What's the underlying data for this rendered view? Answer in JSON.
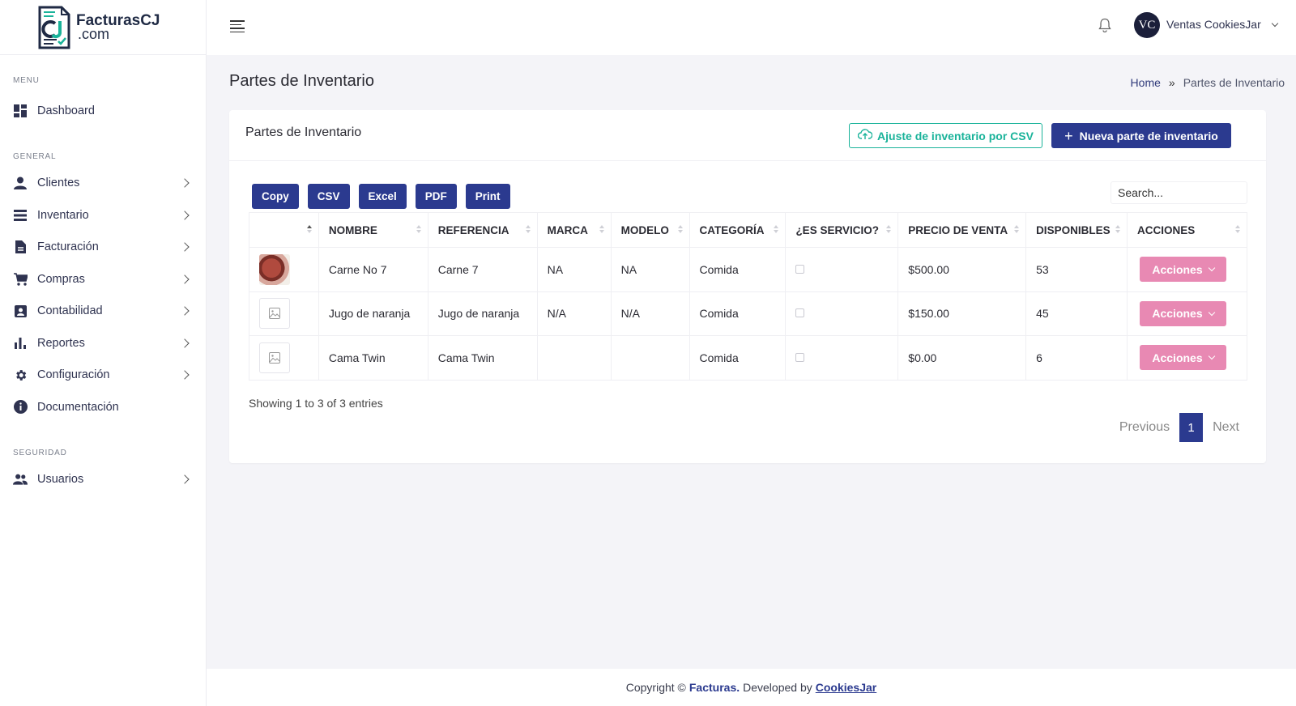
{
  "app": {
    "logo_top": "FacturasCJ",
    "logo_bottom": ".com"
  },
  "sidebar": {
    "sections": [
      {
        "title": "MENU"
      },
      {
        "title": "GENERAL"
      },
      {
        "title": "SEGURIDAD"
      }
    ],
    "items": [
      {
        "label": "Dashboard",
        "icon": "dashboard-grid-icon"
      },
      {
        "label": "Clientes",
        "icon": "user-icon"
      },
      {
        "label": "Inventario",
        "icon": "list-icon"
      },
      {
        "label": "Facturación",
        "icon": "document-icon"
      },
      {
        "label": "Compras",
        "icon": "cart-icon"
      },
      {
        "label": "Contabilidad",
        "icon": "contact-card-icon"
      },
      {
        "label": "Reportes",
        "icon": "bar-chart-icon"
      },
      {
        "label": "Configuración",
        "icon": "gear-icon"
      },
      {
        "label": "Documentación",
        "icon": "info-icon"
      },
      {
        "label": "Usuarios",
        "icon": "users-icon"
      }
    ]
  },
  "topbar": {
    "avatar_initials": "VC",
    "user_name": "Ventas CookiesJar"
  },
  "page": {
    "title": "Partes de Inventario",
    "breadcrumb_home": "Home",
    "breadcrumb_sep": "»",
    "breadcrumb_current": "Partes de Inventario"
  },
  "card": {
    "title": "Partes de Inventario",
    "csv_button": "Ajuste de inventario por CSV",
    "new_button": "Nueva parte de inventario"
  },
  "table_tools": {
    "exports": [
      "Copy",
      "CSV",
      "Excel",
      "PDF",
      "Print"
    ],
    "search_placeholder": "Search..."
  },
  "table": {
    "headers": [
      "NOMBRE",
      "REFERENCIA",
      "MARCA",
      "MODELO",
      "CATEGORÍA",
      "¿ES SERVICIO?",
      "PRECIO DE VENTA",
      "DISPONIBLES",
      "ACCIONES"
    ],
    "rows": [
      {
        "nombre": "Carne No 7",
        "referencia": "Carne 7",
        "marca": "NA",
        "modelo": "NA",
        "categoria": "Comida",
        "precio": "$500.00",
        "disponibles": "53",
        "accion": "Acciones"
      },
      {
        "nombre": "Jugo de naranja",
        "referencia": "Jugo de naranja",
        "marca": "N/A",
        "modelo": "N/A",
        "categoria": "Comida",
        "precio": "$150.00",
        "disponibles": "45",
        "accion": "Acciones"
      },
      {
        "nombre": "Cama Twin",
        "referencia": "Cama Twin",
        "marca": "",
        "modelo": "",
        "categoria": "Comida",
        "precio": "$0.00",
        "disponibles": "6",
        "accion": "Acciones"
      }
    ]
  },
  "pagination": {
    "info": "Showing 1 to 3 of 3 entries",
    "previous": "Previous",
    "page": "1",
    "next": "Next"
  },
  "footer": {
    "prefix": "Copyright ©",
    "brand": "Facturas.",
    "middle": "Developed by",
    "link": "CookiesJar"
  },
  "colors": {
    "primary": "#2b3a8f",
    "accent_teal": "#1ab39a",
    "actions_pink": "#e889b3"
  }
}
